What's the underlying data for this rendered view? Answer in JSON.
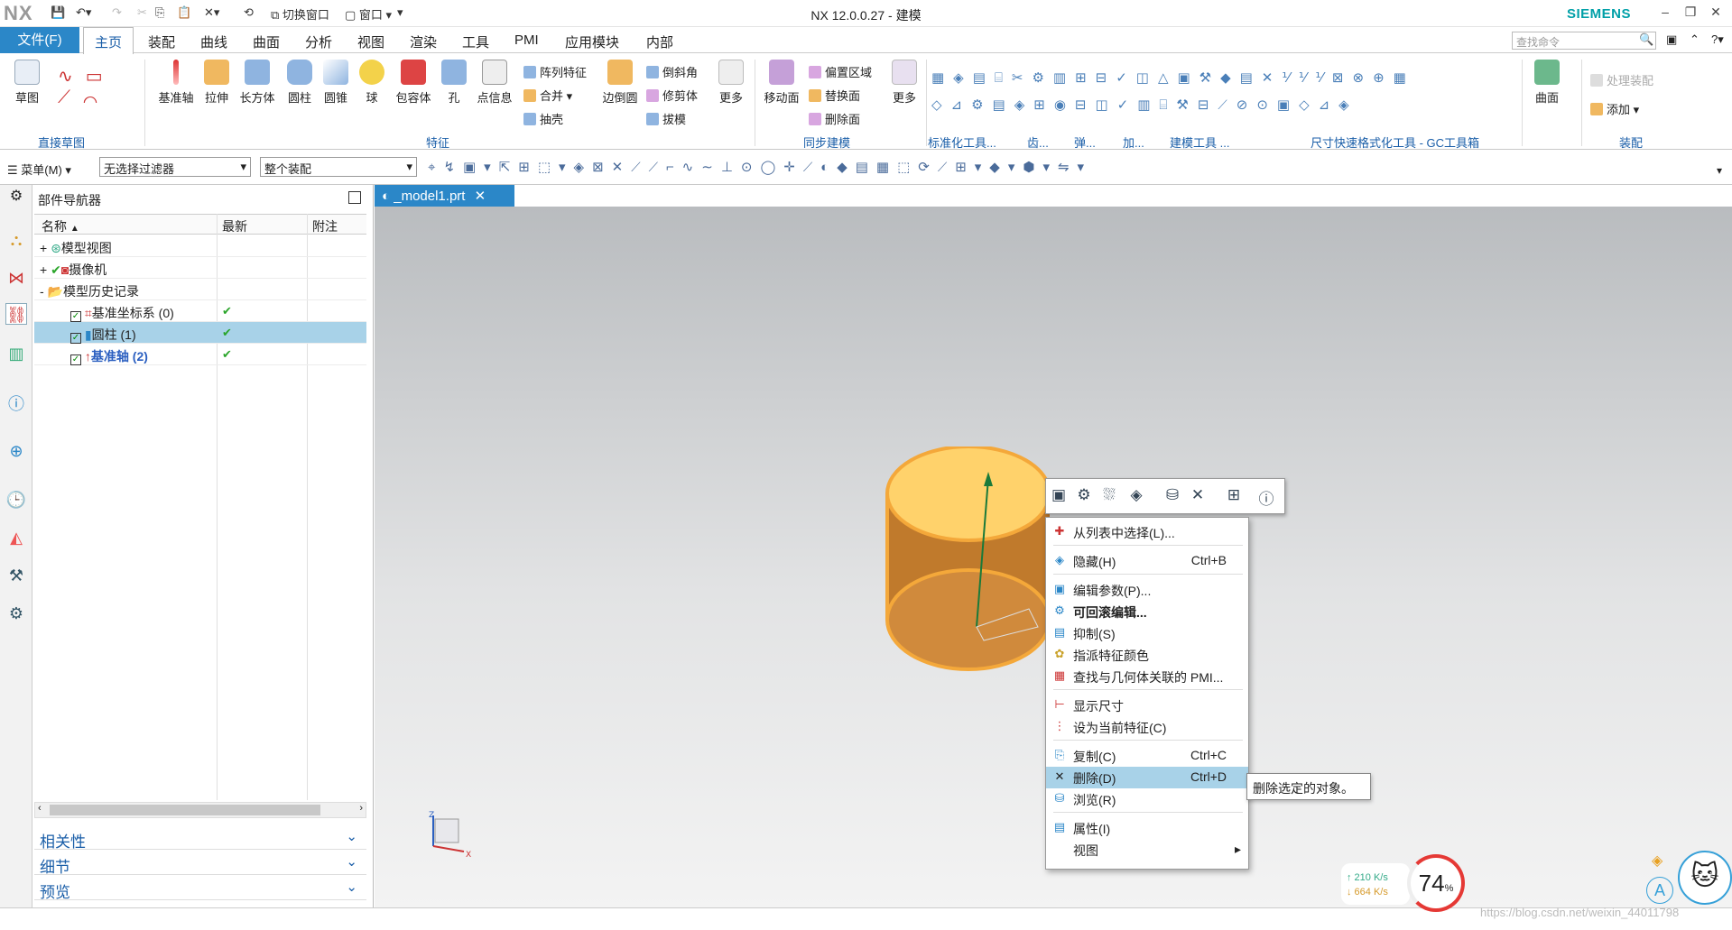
{
  "titlebar": {
    "logo": "NX",
    "title": "NX 12.0.0.27 - 建模",
    "brand": "SIEMENS",
    "switch_window": "切换窗口",
    "window": "窗口"
  },
  "menu": {
    "file": "文件(F)",
    "tabs": [
      "主页",
      "装配",
      "曲线",
      "曲面",
      "分析",
      "视图",
      "渲染",
      "工具",
      "PMI",
      "应用模块",
      "内部"
    ],
    "search_placeholder": "查找命令"
  },
  "ribbon": {
    "sketch": {
      "label": "草图",
      "group": "直接草图"
    },
    "features": [
      "基准轴",
      "拉伸",
      "长方体",
      "圆柱",
      "圆锥",
      "球",
      "包容体",
      "孔",
      "点信息"
    ],
    "features_small": [
      "阵列特征",
      "合并",
      "抽壳"
    ],
    "features_small2": [
      "边倒圆"
    ],
    "features_small3": [
      "倒斜角",
      "修剪体",
      "拔模"
    ],
    "features_more": "更多",
    "features_group": "特征",
    "sync_big": "移动面",
    "sync_small": [
      "偏置区域",
      "替换面",
      "删除面"
    ],
    "sync_more": "更多",
    "sync_group": "同步建模",
    "group_labels": [
      "标准化工具...",
      "齿...",
      "弹...",
      "加...",
      "建模工具 ...",
      "尺寸快速格式化工具 - GC工具箱",
      "装配"
    ],
    "surface": "曲面",
    "assembly_items": [
      "处理装配",
      "添加"
    ]
  },
  "toolbar2": {
    "menu": "菜单(M)",
    "filter": "无选择过滤器",
    "scope": "整个装配"
  },
  "nav": {
    "title": "部件导航器",
    "columns": [
      "名称",
      "最新",
      "附注"
    ],
    "rows": [
      {
        "expand": "+",
        "label": "模型视图",
        "latest": ""
      },
      {
        "expand": "+",
        "label": "摄像机",
        "latest": ""
      },
      {
        "expand": "-",
        "label": "模型历史记录",
        "latest": ""
      },
      {
        "expand": "",
        "label": "基准坐标系 (0)",
        "latest": "✔"
      },
      {
        "expand": "",
        "label": "圆柱 (1)",
        "latest": "✔"
      },
      {
        "expand": "",
        "label": "基准轴 (2)",
        "latest": "✔"
      }
    ],
    "sections": [
      "相关性",
      "细节",
      "预览"
    ]
  },
  "viewport": {
    "tab": "_model1.prt"
  },
  "context_menu": {
    "items": [
      {
        "label": "从列表中选择(L)...",
        "key": "",
        "icon": "plus-icon"
      },
      {
        "label": "隐藏(H)",
        "key": "Ctrl+B",
        "icon": "hide-icon"
      },
      {
        "label": "编辑参数(P)...",
        "key": "",
        "icon": "edit-params-icon"
      },
      {
        "label": "可回滚编辑...",
        "key": "",
        "icon": "rollback-edit-icon"
      },
      {
        "label": "抑制(S)",
        "key": "",
        "icon": "suppress-icon"
      },
      {
        "label": "指派特征颜色",
        "key": "",
        "icon": "color-icon"
      },
      {
        "label": "查找与几何体关联的 PMI...",
        "key": "",
        "icon": "pmi-icon"
      },
      {
        "label": "显示尺寸",
        "key": "",
        "icon": "dimension-icon"
      },
      {
        "label": "设为当前特征(C)",
        "key": "",
        "icon": "current-feature-icon"
      },
      {
        "label": "复制(C)",
        "key": "Ctrl+C",
        "icon": "copy-icon"
      },
      {
        "label": "删除(D)",
        "key": "Ctrl+D",
        "icon": "delete-icon"
      },
      {
        "label": "浏览(R)",
        "key": "",
        "icon": "browse-icon"
      },
      {
        "label": "属性(I)",
        "key": "",
        "icon": "properties-icon"
      },
      {
        "label": "视图",
        "key": "▸",
        "icon": ""
      }
    ]
  },
  "tooltip": "删除选定的对象。",
  "overlay": {
    "up": "↑ 210 K/s",
    "down": "↓ 664 K/s",
    "percent": "74",
    "percent_unit": "%",
    "watermark": "https://blog.csdn.net/weixin_44011798"
  },
  "colors": {
    "accent": "#2b87c8",
    "selection": "#a8d2e8",
    "cylinder": "#f4a83a"
  }
}
